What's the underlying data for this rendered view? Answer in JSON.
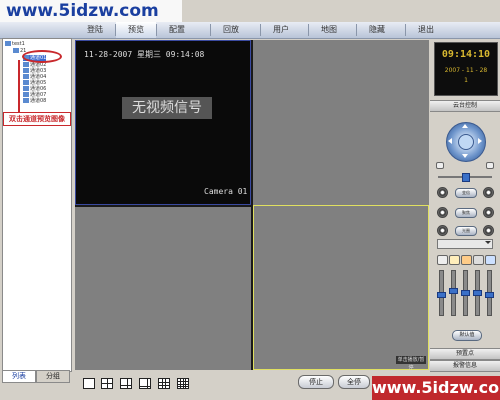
{
  "watermark": {
    "text": "www.5idzw.com"
  },
  "menu": {
    "items": [
      {
        "label": "登陆"
      },
      {
        "label": "预览"
      },
      {
        "label": "配置"
      },
      {
        "label": "回放"
      },
      {
        "label": "用户"
      },
      {
        "label": "地图"
      },
      {
        "label": "隐藏"
      },
      {
        "label": "退出"
      }
    ],
    "active_index": 1
  },
  "tree": {
    "root": "test1",
    "node": "21",
    "channels": [
      "通道01",
      "通道02",
      "通道03",
      "通道04",
      "通道05",
      "通道06",
      "通道07",
      "通道08"
    ]
  },
  "callout": {
    "text": "双击通道预览图像"
  },
  "left_tabs": [
    "列表",
    "分组"
  ],
  "video": {
    "timestamp": "11-28-2007  星期三  09:14:08",
    "no_signal": "无视频信号",
    "camera_label": "Camera 01",
    "cell4_tag": "单击播放/暂停"
  },
  "toolbar": {
    "stop_label": "停止",
    "stop_all_label": "全停"
  },
  "right": {
    "clock_time": "09:14:10",
    "clock_date": "2007 - 11 - 28",
    "clock_index": "1",
    "ptz_header": "云台控制",
    "pills": [
      "变倍",
      "聚焦",
      "光圈"
    ],
    "apply_label": "默认值",
    "preset_header": "预置点",
    "alarm_header": "报警信息"
  },
  "sliders": [
    0.45,
    0.55,
    0.5,
    0.5,
    0.45
  ],
  "colors": {
    "accent": "#3a4aa0",
    "alarm": "#c8282c",
    "clock": "#d8b830",
    "selection": "#e0e060"
  }
}
